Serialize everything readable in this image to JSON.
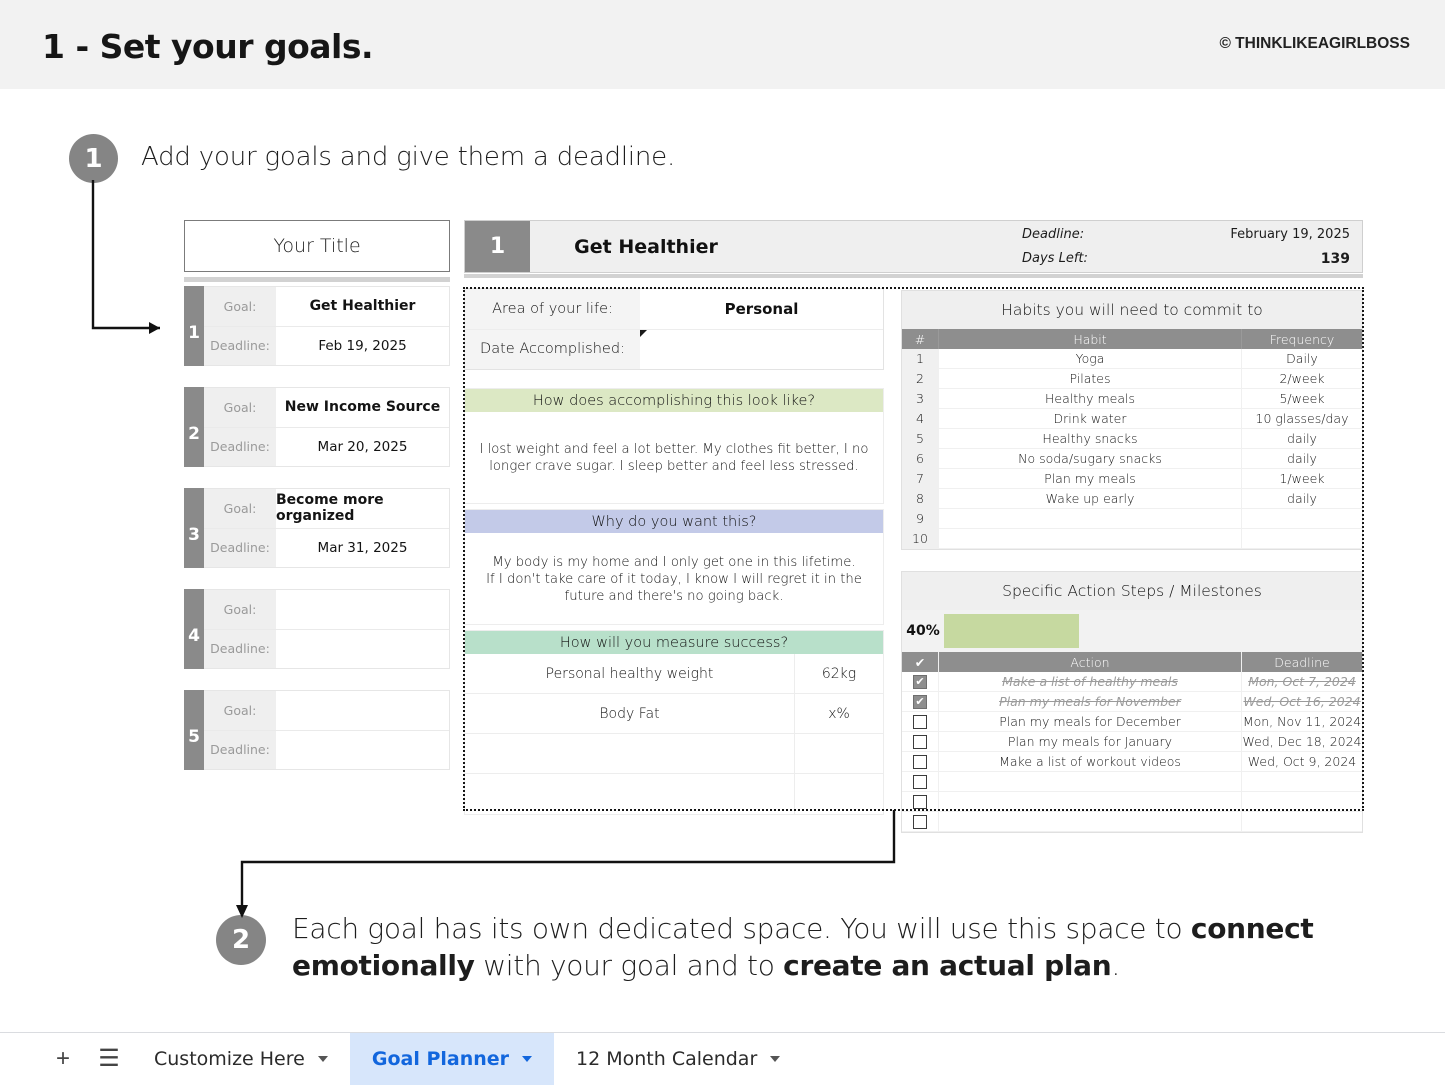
{
  "banner": {
    "title": "1 - Set your goals.",
    "credit": "© THINKLIKEAGIRLBOSS"
  },
  "callouts": [
    {
      "num": "1",
      "text": "Add your goals and give them a deadline."
    },
    {
      "num": "2",
      "text_part1": "Each goal has its own dedicated space. You will use this space to ",
      "bold1": "connect emotionally",
      "text_part2": " with your goal and to ",
      "bold2": "create an actual plan",
      "text_part3": "."
    }
  ],
  "title_box": {
    "value": "Your Title"
  },
  "goal_list": {
    "label_goal": "Goal:",
    "label_deadline": "Deadline:",
    "items": [
      {
        "index": "1",
        "goal": "Get Healthier",
        "deadline": "Feb 19, 2025"
      },
      {
        "index": "2",
        "goal": "New Income Source",
        "deadline": "Mar 20, 2025"
      },
      {
        "index": "3",
        "goal": "Become more organized",
        "deadline": "Mar 31, 2025"
      },
      {
        "index": "4",
        "goal": "",
        "deadline": ""
      },
      {
        "index": "5",
        "goal": "",
        "deadline": ""
      }
    ]
  },
  "goal_header": {
    "index": "1",
    "name": "Get Healthier",
    "deadline_label": "Deadline:",
    "deadline_value": "February 19, 2025",
    "days_left_label": "Days Left:",
    "days_left_value": "139"
  },
  "area": {
    "label_area": "Area of your life:",
    "value_area": "Personal",
    "label_date": "Date Accomplished:",
    "value_date": ""
  },
  "sections": [
    {
      "heading": "How does accomplishing this look like?",
      "heading_bg": "#dce8c4",
      "body": "I lost weight and feel a lot better. My clothes fit better, I no longer crave sugar. I sleep better and feel less stressed."
    },
    {
      "heading": "Why do you want this?",
      "heading_bg": "#c3cae8",
      "body": "My body is my home and I only get one in this lifetime.\nIf I don't take care of it today, I know I will regret it in the future and there's no going back."
    }
  ],
  "metrics": {
    "heading": "How will you measure success?",
    "heading_bg": "#b8e0ca",
    "rows": [
      {
        "name": "Personal healthy weight",
        "value": "62kg"
      },
      {
        "name": "Body Fat",
        "value": "x%"
      },
      {
        "name": "",
        "value": ""
      },
      {
        "name": "",
        "value": ""
      }
    ]
  },
  "habits": {
    "title": "Habits you will need to commit to",
    "columns": [
      "#",
      "Habit",
      "Frequency"
    ],
    "rows": [
      {
        "n": "1",
        "habit": "Yoga",
        "freq": "Daily"
      },
      {
        "n": "2",
        "habit": "Pilates",
        "freq": "2/week"
      },
      {
        "n": "3",
        "habit": "Healthy meals",
        "freq": "5/week"
      },
      {
        "n": "4",
        "habit": "Drink water",
        "freq": "10 glasses/day"
      },
      {
        "n": "5",
        "habit": "Healthy snacks",
        "freq": "daily"
      },
      {
        "n": "6",
        "habit": "No soda/sugary snacks",
        "freq": "daily"
      },
      {
        "n": "7",
        "habit": "Plan my meals",
        "freq": "1/week"
      },
      {
        "n": "8",
        "habit": "Wake up early",
        "freq": "daily"
      },
      {
        "n": "9",
        "habit": "",
        "freq": ""
      },
      {
        "n": "10",
        "habit": "",
        "freq": ""
      }
    ]
  },
  "milestones": {
    "title": "Specific Action Steps / Milestones",
    "progress_percent_label": "40%",
    "progress_percent": 40,
    "progress_color": "#c6d9a0",
    "columns": [
      "✔",
      "Action",
      "Deadline"
    ],
    "rows": [
      {
        "checked": true,
        "action": "Make a list of healthy meals",
        "deadline": "Mon, Oct 7, 2024"
      },
      {
        "checked": true,
        "action": "Plan my meals for November",
        "deadline": "Wed, Oct 16, 2024"
      },
      {
        "checked": false,
        "action": "Plan my meals for December",
        "deadline": "Mon, Nov 11, 2024"
      },
      {
        "checked": false,
        "action": "Plan my meals for January",
        "deadline": "Wed, Dec 18, 2024"
      },
      {
        "checked": false,
        "action": "Make a list of workout videos",
        "deadline": "Wed, Oct 9, 2024"
      },
      {
        "checked": false,
        "action": "",
        "deadline": ""
      },
      {
        "checked": false,
        "action": "",
        "deadline": ""
      },
      {
        "checked": false,
        "action": "",
        "deadline": ""
      }
    ]
  },
  "tabbar": {
    "add_icon": "+",
    "menu_icon": "☰",
    "tabs": [
      {
        "label": "Customize Here",
        "active": false
      },
      {
        "label": "Goal Planner",
        "active": true
      },
      {
        "label": "12 Month Calendar",
        "active": false
      }
    ]
  }
}
